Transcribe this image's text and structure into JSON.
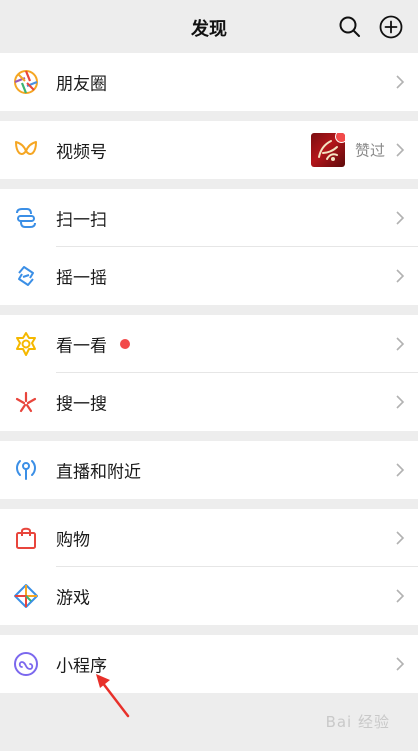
{
  "header": {
    "title": "发现",
    "search_icon": "search-icon",
    "add_icon": "plus-circle-icon"
  },
  "menu": {
    "moments": {
      "label": "朋友圈",
      "icon": "moments-aperture-icon"
    },
    "channels": {
      "label": "视频号",
      "icon": "channels-butterfly-icon",
      "praise_text": "赞过"
    },
    "scan": {
      "label": "扫一扫",
      "icon": "scan-icon"
    },
    "shake": {
      "label": "摇一摇",
      "icon": "shake-icon"
    },
    "top_stories": {
      "label": "看一看",
      "icon": "top-stories-icon"
    },
    "search": {
      "label": "搜一搜",
      "icon": "search-flower-icon"
    },
    "live_nearby": {
      "label": "直播和附近",
      "icon": "live-nearby-icon"
    },
    "shopping": {
      "label": "购物",
      "icon": "shopping-bag-icon"
    },
    "games": {
      "label": "游戏",
      "icon": "game-diamond-icon"
    },
    "mini_programs": {
      "label": "小程序",
      "icon": "mini-program-icon"
    }
  },
  "watermark": {
    "text": "Bai 经验"
  },
  "colors": {
    "background": "#ededed",
    "badge_red": "#f24a4a",
    "chevron": "#b2b2b2",
    "annotation_arrow": "#e8302a"
  }
}
